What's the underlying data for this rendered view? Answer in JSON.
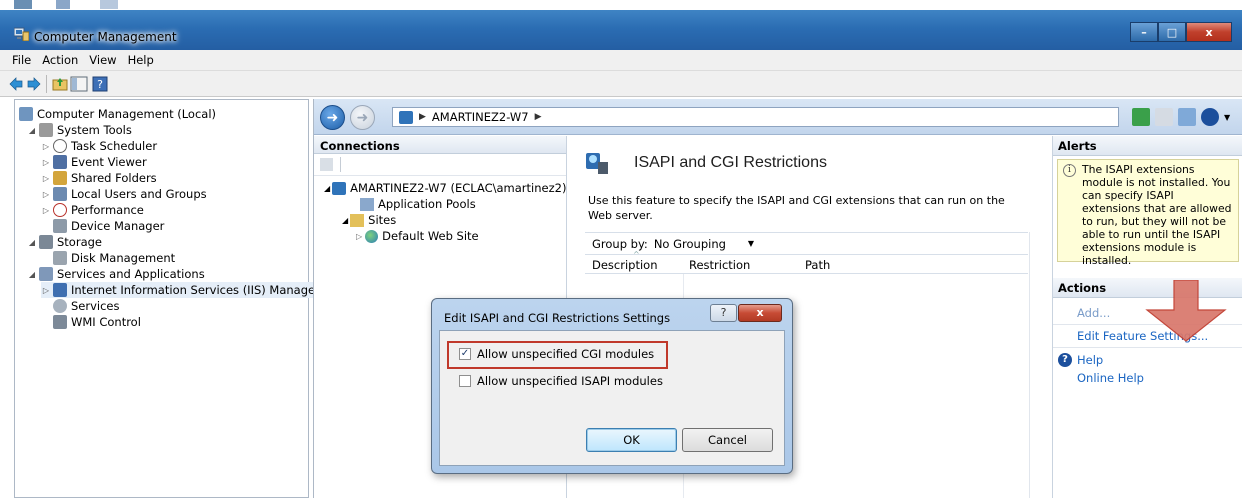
{
  "window": {
    "title": "Computer Management",
    "minimize": "–",
    "maximize": "□",
    "close": "x"
  },
  "menu": [
    "File",
    "Action",
    "View",
    "Help"
  ],
  "tree": {
    "root": "Computer Management (Local)",
    "system_tools": "System Tools",
    "task_scheduler": "Task Scheduler",
    "event_viewer": "Event Viewer",
    "shared_folders": "Shared Folders",
    "local_users": "Local Users and Groups",
    "performance": "Performance",
    "device_manager": "Device Manager",
    "storage": "Storage",
    "disk_management": "Disk Management",
    "services_apps": "Services and Applications",
    "iis_manager": "Internet Information Services (IIS) Manager",
    "services": "Services",
    "wmi": "WMI Control"
  },
  "iis": {
    "breadcrumb": "AMARTINEZ2-W7",
    "connections_title": "Connections",
    "server_node": "AMARTINEZ2-W7 (ECLAC\\amartinez2)",
    "app_pools": "Application Pools",
    "sites": "Sites",
    "default_site": "Default Web Site",
    "feature_title": "ISAPI and CGI Restrictions",
    "feature_desc": "Use this feature to specify the ISAPI and CGI extensions that can run on the Web server.",
    "group_by_label": "Group by:",
    "group_by_value": "No Grouping",
    "columns": [
      "Description",
      "Restriction",
      "Path"
    ]
  },
  "alerts": {
    "title": "Alerts",
    "message": "The ISAPI extensions module is not installed. You can specify ISAPI extensions that are allowed to run, but they will not be able to run until the ISAPI extensions module is installed."
  },
  "actions": {
    "title": "Actions",
    "add": "Add...",
    "edit_settings": "Edit Feature Settings...",
    "help": "Help",
    "online_help": "Online Help"
  },
  "dialog": {
    "title": "Edit ISAPI and CGI Restrictions Settings",
    "help_btn": "?",
    "close_btn": "x",
    "allow_cgi": "Allow unspecified CGI modules",
    "allow_cgi_checked": true,
    "allow_isapi": "Allow unspecified ISAPI modules",
    "allow_isapi_checked": false,
    "ok": "OK",
    "cancel": "Cancel"
  },
  "colors": {
    "titlebar": "#2b6db3",
    "annotation_red": "#c0392b",
    "link_blue": "#1a65c2"
  }
}
